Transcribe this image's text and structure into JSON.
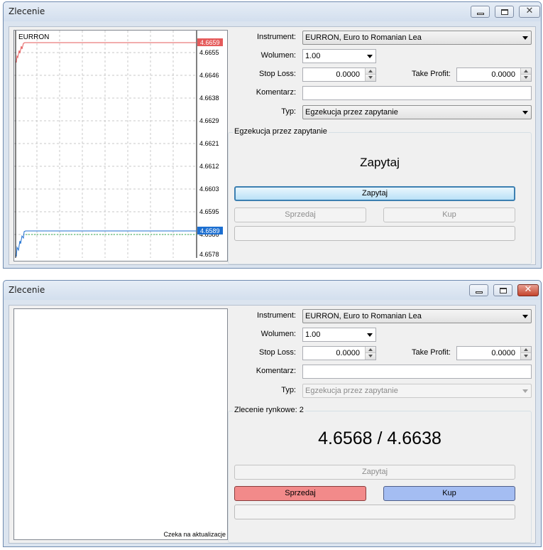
{
  "window1": {
    "title": "Zlecenie",
    "chart": {
      "symbol": "EURRON",
      "price_labels": [
        "4.6655",
        "4.6646",
        "4.6638",
        "4.6629",
        "4.6621",
        "4.6612",
        "4.6603",
        "4.6595",
        "4.6586",
        "4.6578"
      ],
      "ask_badge": "4.6659",
      "bid_badge": "4.6589",
      "ask_color": "#e55b5b",
      "bid_color": "#1c6fd1"
    },
    "form": {
      "instrument_label": "Instrument:",
      "instrument_value": "EURRON, Euro to Romanian Lea",
      "volume_label": "Wolumen:",
      "volume_value": "1.00",
      "stoploss_label": "Stop Loss:",
      "stoploss_value": "0.0000",
      "takeprofit_label": "Take Profit:",
      "takeprofit_value": "0.0000",
      "comment_label": "Komentarz:",
      "comment_value": "",
      "type_label": "Typ:",
      "type_value": "Egzekucja przez zapytanie"
    },
    "panel": {
      "group_title": "Egzekucja przez zapytanie",
      "heading": "Zapytaj",
      "request_button": "Zapytaj",
      "sell_button": "Sprzedaj",
      "buy_button": "Kup"
    }
  },
  "window2": {
    "title": "Zlecenie",
    "chart": {
      "status_note": "Czeka na aktualizacje"
    },
    "form": {
      "instrument_label": "Instrument:",
      "instrument_value": "EURRON, Euro to Romanian Lea",
      "volume_label": "Wolumen:",
      "volume_value": "1.00",
      "stoploss_label": "Stop Loss:",
      "stoploss_value": "0.0000",
      "takeprofit_label": "Take Profit:",
      "takeprofit_value": "0.0000",
      "comment_label": "Komentarz:",
      "comment_value": "",
      "type_label": "Typ:",
      "type_value": "Egzekucja przez zapytanie"
    },
    "panel": {
      "group_title": "Zlecenie rynkowe: 2",
      "quote": "4.6568 / 4.6638",
      "request_button": "Zapytaj",
      "sell_button": "Sprzedaj",
      "buy_button": "Kup",
      "sell_color": "#f28a8a",
      "buy_color": "#a4bdf2"
    }
  }
}
